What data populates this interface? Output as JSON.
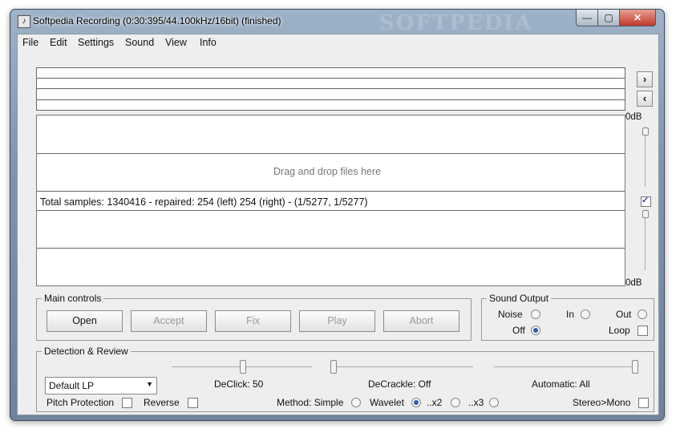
{
  "window": {
    "title": "Softpedia Recording (0:30:395/44.100kHz/16bit) (finished)",
    "watermark": "SOFTPEDIA",
    "controls": {
      "minimize": "—",
      "maximize": "▢",
      "close": "✕"
    }
  },
  "menu": [
    "File",
    "Edit",
    "Settings",
    "Sound",
    "View",
    "Info"
  ],
  "nav": {
    "forward": "›",
    "back": "‹"
  },
  "panel": {
    "drop_hint": "Drag and drop files here",
    "status": "Total samples: 1340416 - repaired: 254 (left) 254 (right)  - (1/5277, 1/5277)"
  },
  "levels": {
    "top_db": "0dB",
    "bottom_db": "0dB",
    "checked": true
  },
  "main_controls": {
    "title": "Main controls",
    "buttons": [
      {
        "label": "Open",
        "enabled": true
      },
      {
        "label": "Accept",
        "enabled": false
      },
      {
        "label": "Fix",
        "enabled": false
      },
      {
        "label": "Play",
        "enabled": false
      },
      {
        "label": "Abort",
        "enabled": false
      }
    ]
  },
  "sound_output": {
    "title": "Sound Output",
    "noise": {
      "label": "Noise",
      "selected": false
    },
    "in": {
      "label": "In",
      "selected": false
    },
    "out": {
      "label": "Out",
      "selected": false
    },
    "off": {
      "label": "Off",
      "selected": true
    },
    "loop": {
      "label": "Loop",
      "checked": false
    }
  },
  "detection": {
    "title": "Detection & Review",
    "preset": "Default LP",
    "sliders": [
      {
        "label": "DeClick: 50",
        "value": 0.5
      },
      {
        "label": "DeCrackle: Off",
        "value": 0.0
      },
      {
        "label": "Automatic: All",
        "value": 1.0
      }
    ],
    "pitch_protection": {
      "label": "Pitch Protection",
      "checked": false
    },
    "reverse": {
      "label": "Reverse",
      "checked": false
    },
    "method_label": "Method: Simple",
    "wavelet_label": "Wavelet",
    "x2_label": "..x2",
    "x3_label": "..x3",
    "method_selected": "wavelet",
    "stereo_mono": {
      "label": "Stereo>Mono",
      "checked": false
    }
  }
}
